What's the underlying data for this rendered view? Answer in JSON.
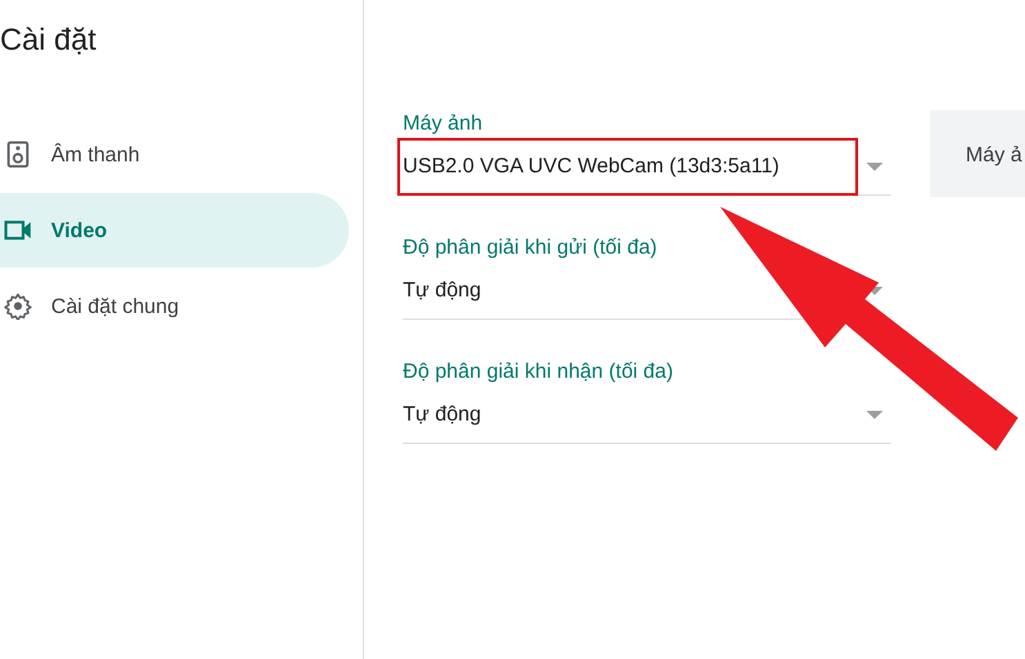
{
  "title": "Cài đặt",
  "sidebar": {
    "items": [
      {
        "label": "Âm thanh",
        "selected": false
      },
      {
        "label": "Video",
        "selected": true
      },
      {
        "label": "Cài đặt chung",
        "selected": false
      }
    ]
  },
  "fields": [
    {
      "label": "Máy ảnh",
      "value": "USB2.0 VGA UVC WebCam (13d3:5a11)",
      "highlighted": true
    },
    {
      "label": "Độ phân giải khi gửi (tối đa)",
      "value": "Tự động",
      "highlighted": false
    },
    {
      "label": "Độ phân giải khi nhận (tối đa)",
      "value": "Tự động",
      "highlighted": false
    }
  ],
  "preview_button": {
    "label": "Máy ả"
  }
}
